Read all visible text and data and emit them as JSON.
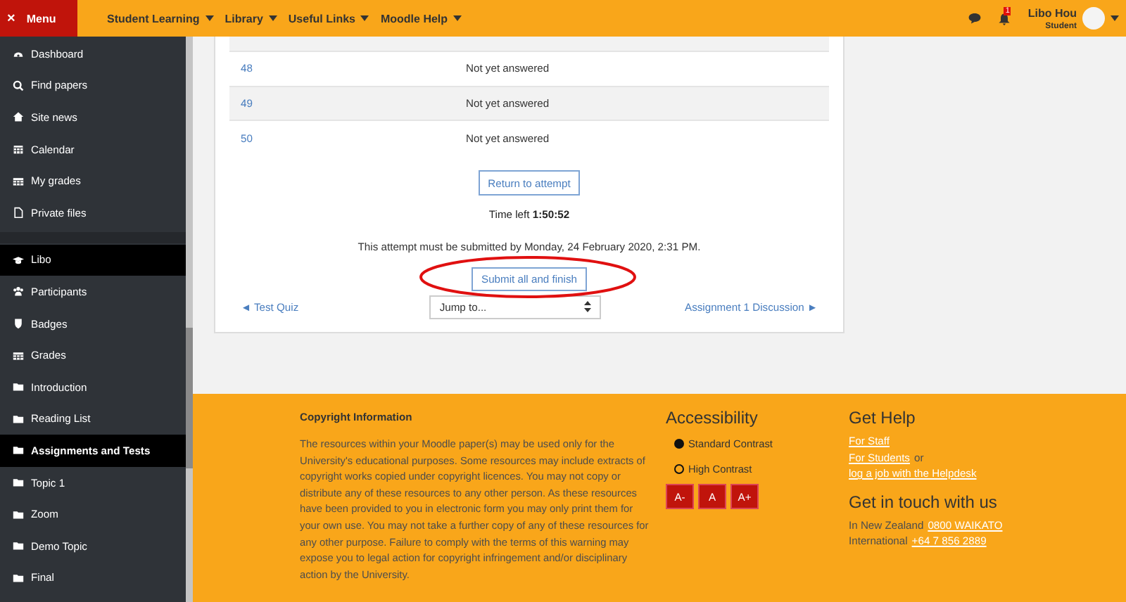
{
  "navbar": {
    "menu_button": {
      "icon": "×",
      "label": "Menu"
    },
    "menus": [
      {
        "label": "Student Learning"
      },
      {
        "label": "Library"
      },
      {
        "label": "Useful Links"
      },
      {
        "label": "Moodle Help"
      }
    ],
    "notification_count": "1",
    "user": {
      "name": "Libo Hou",
      "role": "Student"
    }
  },
  "sidebar": {
    "groups": [
      {
        "items": [
          {
            "kind": "dashboard",
            "label": "Dashboard",
            "selected": false
          },
          {
            "kind": "search",
            "label": "Find papers",
            "selected": false
          },
          {
            "kind": "home",
            "label": "Site news",
            "selected": false
          },
          {
            "kind": "calendar",
            "label": "Calendar",
            "selected": false
          },
          {
            "kind": "grid",
            "label": "My grades",
            "selected": false
          },
          {
            "kind": "file",
            "label": "Private files",
            "selected": false
          }
        ]
      },
      {
        "items": [
          {
            "kind": "cap",
            "label": "Libo",
            "selected": true
          },
          {
            "kind": "users",
            "label": "Participants",
            "selected": false
          },
          {
            "kind": "shield",
            "label": "Badges",
            "selected": false
          },
          {
            "kind": "grid",
            "label": "Grades",
            "selected": false
          },
          {
            "kind": "folder",
            "label": "Introduction",
            "selected": false
          },
          {
            "kind": "folder",
            "label": "Reading List",
            "selected": false
          },
          {
            "kind": "folder",
            "label": "Assignments and Tests",
            "selected": true
          },
          {
            "kind": "folder",
            "label": "Topic 1",
            "selected": false
          },
          {
            "kind": "folder",
            "label": "Zoom",
            "selected": false
          },
          {
            "kind": "folder",
            "label": "Demo Topic",
            "selected": false
          },
          {
            "kind": "folder",
            "label": "Final",
            "selected": false
          }
        ]
      }
    ]
  },
  "summary": {
    "rows": [
      {
        "question": "48",
        "status": "Not yet answered"
      },
      {
        "question": "49",
        "status": "Not yet answered"
      },
      {
        "question": "50",
        "status": "Not yet answered"
      }
    ],
    "return_button": "Return to attempt",
    "time_left_label": "Time left",
    "time_left": "1:50:52",
    "deadline": "This attempt must be submitted by Monday, 24 February 2020, 2:31 PM.",
    "submit_button": {
      "label": "Submit all and finish",
      "highlighted": true
    },
    "prev_link": "◄ Test Quiz",
    "jump_select": {
      "value": "Jump to..."
    },
    "next_link": "Assignment 1 Discussion ►"
  },
  "footer": {
    "copyright": {
      "title": "Copyright Information",
      "text": "The resources within your Moodle paper(s) may be used only for the University's educational purposes. Some resources may include extracts of copyright works copied under copyright licences. You may not copy or distribute any of these resources to any other person. As these resources have been provided to you in electronic form you may only print them for your own use. You may not take a further copy of any of these resources for any other purpose. Failure to comply with the terms of this warning may expose you to legal action for copyright infringement and/or disciplinary action by the University."
    },
    "accessibility": {
      "title": "Accessibility",
      "contrast": [
        {
          "label": "Standard Contrast",
          "selected": true
        },
        {
          "label": "High Contrast",
          "selected": false
        }
      ],
      "font_buttons": [
        "A-",
        "A",
        "A+"
      ]
    },
    "help": {
      "title": "Get Help",
      "staff_link": "For Staff",
      "students_link": "For Students",
      "or": "or",
      "helpdesk_link": "log a job with the Helpdesk"
    },
    "contact": {
      "title": "Get in touch with us",
      "lines": [
        {
          "label": "In New Zealand",
          "link": "0800 WAIKATO"
        },
        {
          "label": "International",
          "link": "+64 7 856 2889"
        }
      ]
    }
  }
}
